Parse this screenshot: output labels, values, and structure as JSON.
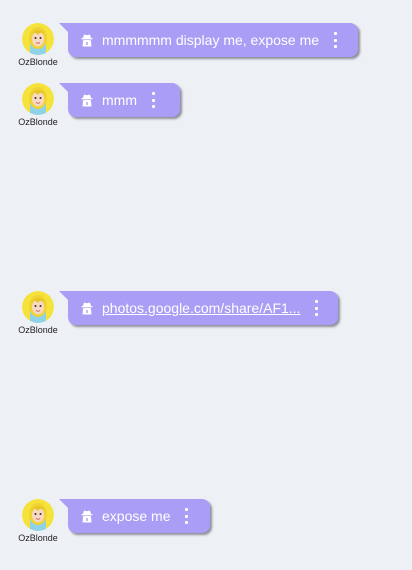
{
  "messages": [
    {
      "username": "OzBlonde",
      "text": "mmmmmm display me, expose me",
      "is_link": false
    },
    {
      "username": "OzBlonde",
      "text": "mmm",
      "is_link": false
    },
    {
      "username": "OzBlonde",
      "text": "photos.google.com/share/AF1...",
      "is_link": true
    },
    {
      "username": "OzBlonde",
      "text": "expose me",
      "is_link": false
    }
  ],
  "colors": {
    "background": "#edf1f5",
    "bubble": "#a99df5",
    "bubble_text": "#ffffff"
  },
  "icons": {
    "bubble_icon": "anonymous-spy-icon",
    "menu_icon": "kebab-menu-icon",
    "avatar": "blonde-woman-avatar"
  }
}
